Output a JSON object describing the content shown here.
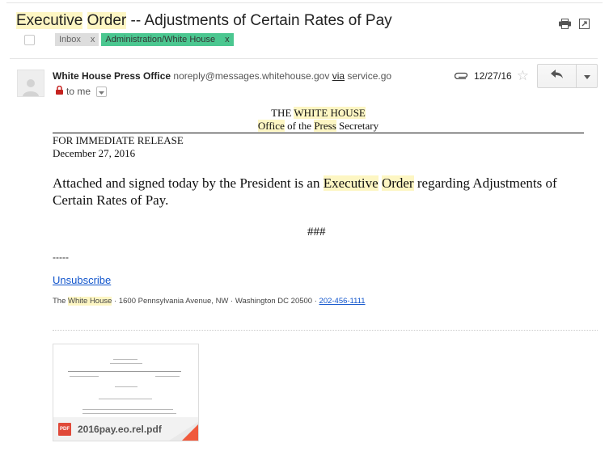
{
  "email": {
    "subject_parts": [
      "Executive",
      " ",
      "Order",
      " -- Adjustments of Certain Rates of Pay"
    ],
    "labels": [
      {
        "name": "Inbox",
        "remove": "x"
      },
      {
        "name": "Administration/White House",
        "remove": "x"
      }
    ],
    "sender": {
      "name": "White House Press Office",
      "email": "noreply@messages.whitehouse.gov",
      "via_word": "via",
      "via_domain": "service.go"
    },
    "to_label": "to me",
    "date": "12/27/16"
  },
  "body": {
    "letterhead_line1": [
      "THE ",
      "WHITE HOUSE"
    ],
    "letterhead_line2": [
      "Office",
      " of the ",
      "Press",
      " Secretary"
    ],
    "release": "FOR IMMEDIATE RELEASE",
    "release_date": "December 27, 2016",
    "paragraph": [
      "Attached and signed today by the President is an ",
      "Executive",
      " ",
      "Order",
      " regarding Adjustments of Certain Rates of Pay."
    ],
    "hashes": "###",
    "dashes": "-----",
    "unsubscribe": "Unsubscribe",
    "footer": [
      "The ",
      "White House",
      " · 1600 Pennsylvania Avenue, NW · Washington DC 20500 · ",
      "202-456-1111"
    ]
  },
  "attachment": {
    "filename": "2016pay.eo.rel.pdf",
    "type_badge": "PDF"
  },
  "colors": {
    "highlight": "#fdf6c3",
    "label_admin": "#4bc790",
    "label_inbox": "#dddddd",
    "link": "#1155cc",
    "pdf_red": "#e04a3a"
  },
  "icons": [
    "print-icon",
    "new-window-icon",
    "checkbox-icon",
    "avatar-icon",
    "lock-icon",
    "chevron-down-icon",
    "paperclip-icon",
    "star-icon",
    "reply-icon",
    "pdf-icon"
  ]
}
